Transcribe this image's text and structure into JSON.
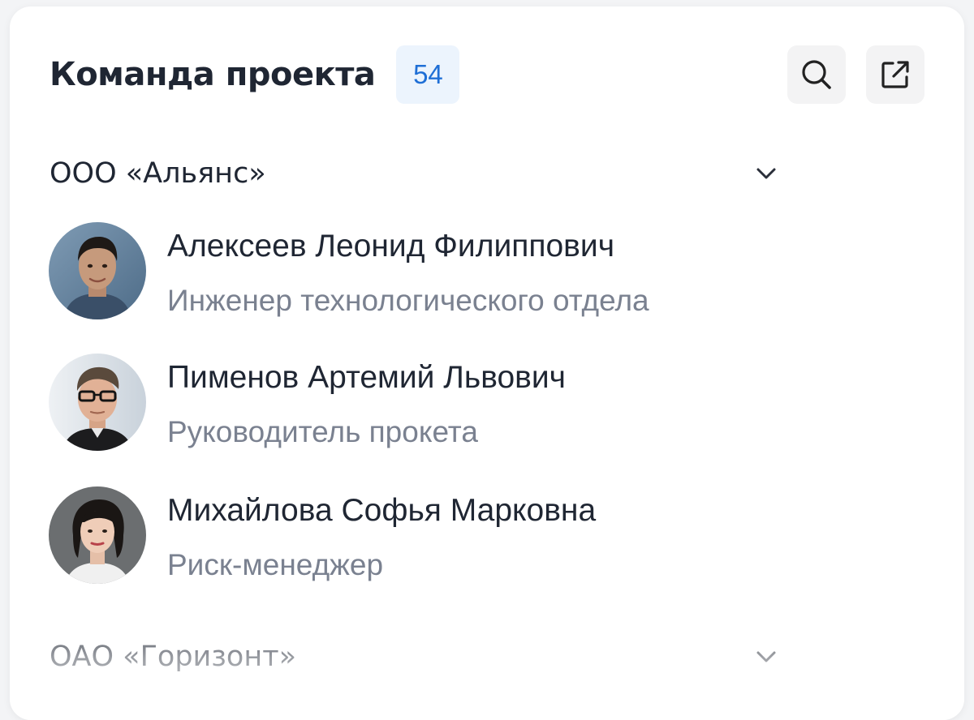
{
  "header": {
    "title": "Команда проекта",
    "count": "54",
    "search_icon": "search-icon",
    "open_icon": "external-link-icon"
  },
  "groups": [
    {
      "name": "ООО «Альянс»",
      "expanded": true,
      "icon": "chevron-down-icon",
      "members": [
        {
          "name": "Алексеев Леонид Филиппович",
          "role": "Инженер технологического отдела"
        },
        {
          "name": "Пименов Артемий Львович",
          "role": "Руководитель прокета"
        },
        {
          "name": "Михайлова Софья Марковна",
          "role": "Риск-менеджер"
        }
      ]
    },
    {
      "name": "ОАО «Горизонт»",
      "expanded": false,
      "icon": "chevron-down-icon"
    }
  ],
  "colors": {
    "accent": "#1f6fd6",
    "badge_bg": "#ecf4fd",
    "text_primary": "#1f2633",
    "text_secondary": "#7a8190",
    "button_bg": "#f3f3f4"
  }
}
